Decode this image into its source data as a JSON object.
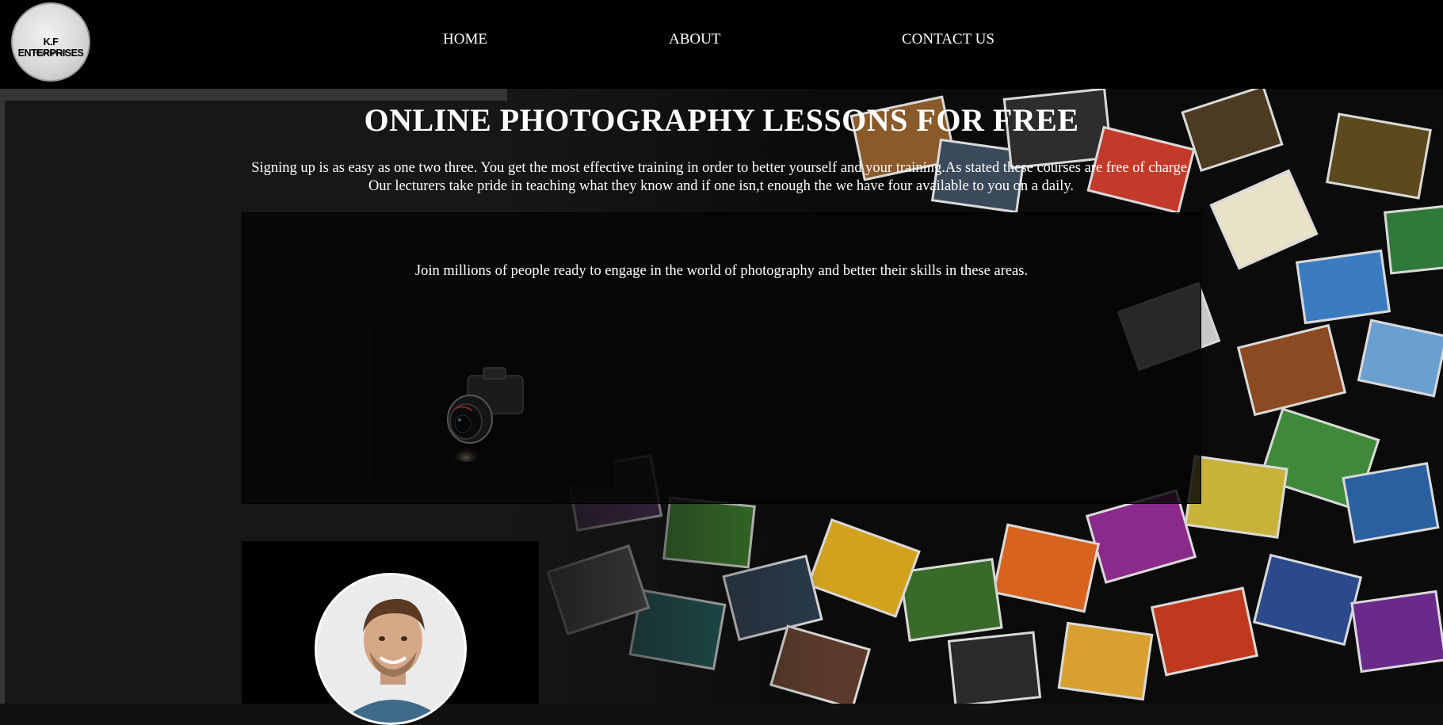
{
  "nav": {
    "logo": {
      "title": "K.F ENTERPRISES",
      "tagline": "~Risking It All~"
    },
    "links": [
      {
        "label": "HOME"
      },
      {
        "label": "ABOUT"
      },
      {
        "label": "CONTACT US"
      }
    ]
  },
  "main": {
    "title": "ONLINE PHOTOGRAPHY LESSONS FOR FREE",
    "intro": "Signing up is as easy as one two three. You get the most effective training in order to better yourself and your training.As stated these courses are free of charge. Our lecturers take pride in teaching what they know and if one isn,t enough the we have four available to you on a daily.",
    "panel_text": "Join millions of people ready to engage in the world of photography and better their skills in these areas."
  },
  "colors": {
    "nav_bg": "#000000",
    "page_bg": "#171717",
    "text": "#ffffff"
  }
}
